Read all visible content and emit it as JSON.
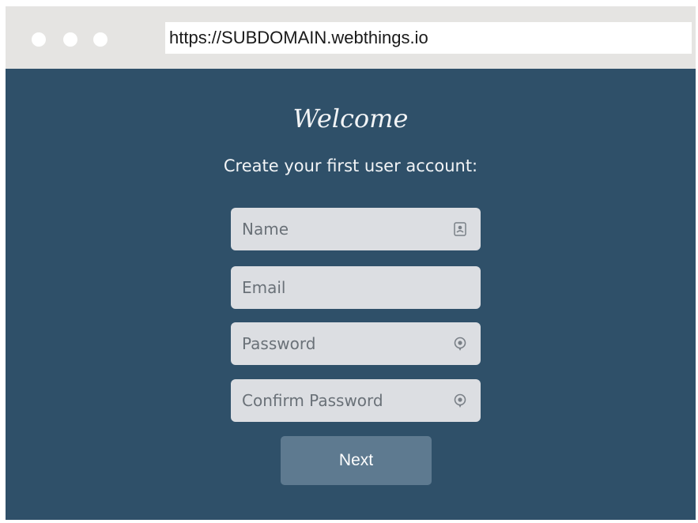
{
  "browser": {
    "url": "https://SUBDOMAIN.webthings.io",
    "window_dots": [
      "traffic-dot",
      "traffic-dot",
      "traffic-dot"
    ]
  },
  "page": {
    "title": "Welcome",
    "subtitle": "Create your first user account:",
    "form": {
      "name_placeholder": "Name",
      "name_icon": "contact-card-icon",
      "email_placeholder": "Email",
      "password_placeholder": "Password",
      "password_icon": "key-icon",
      "confirm_password_placeholder": "Confirm Password",
      "confirm_password_icon": "key-icon",
      "next_label": "Next"
    }
  },
  "colors": {
    "background": "#2f5069",
    "chrome": "#e5e4e2",
    "field": "#dcdee2",
    "button": "#5e7a90"
  }
}
